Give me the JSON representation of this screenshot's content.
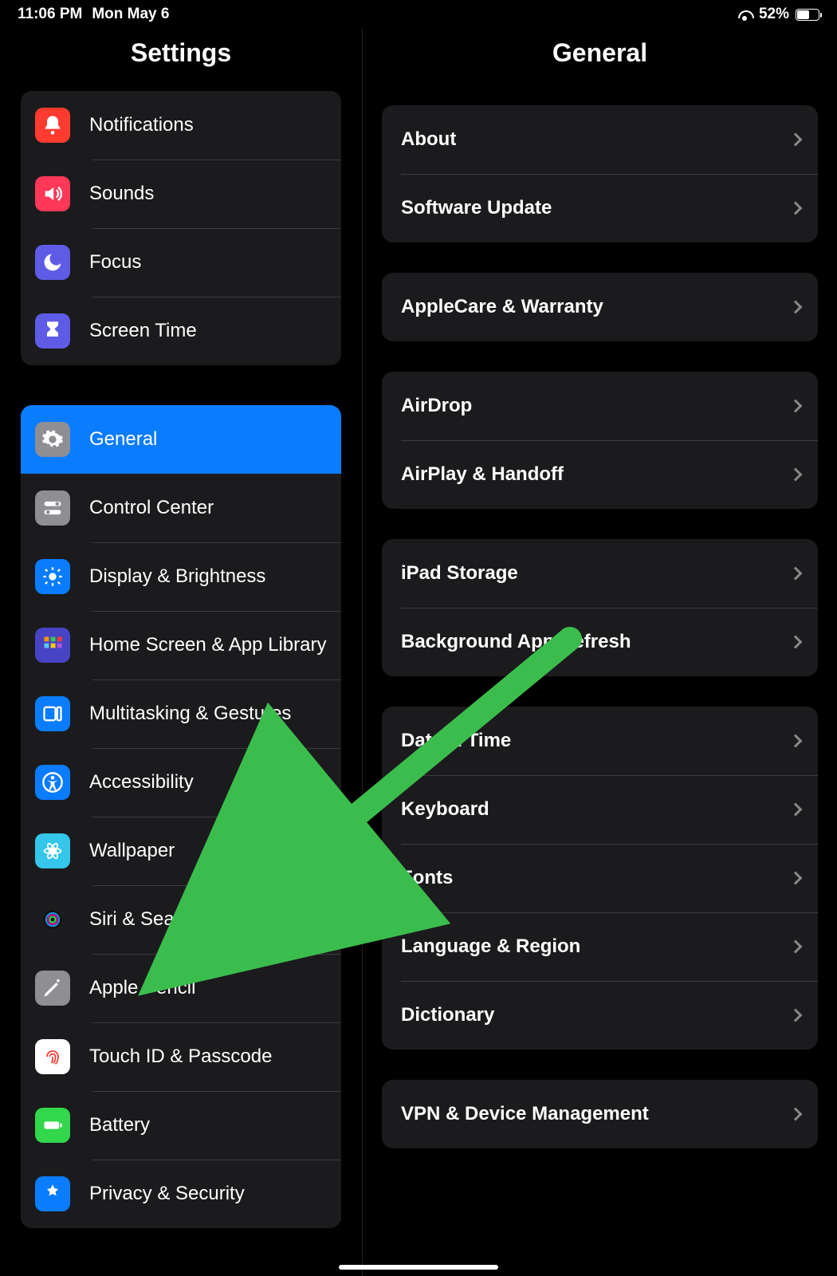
{
  "statusbar": {
    "time": "11:06 PM",
    "date": "Mon May 6",
    "battery_pct": "52%"
  },
  "sidebar": {
    "title": "Settings",
    "sections": [
      {
        "items": [
          {
            "id": "notifications",
            "label": "Notifications",
            "icon": "bell-badge-icon",
            "color": "#ff3b30"
          },
          {
            "id": "sounds",
            "label": "Sounds",
            "icon": "speaker-icon",
            "color": "#ff3758"
          },
          {
            "id": "focus",
            "label": "Focus",
            "icon": "moon-icon",
            "color": "#5e5ce6"
          },
          {
            "id": "screen-time",
            "label": "Screen Time",
            "icon": "hourglass-icon",
            "color": "#5e5ce6"
          }
        ]
      },
      {
        "items": [
          {
            "id": "general",
            "label": "General",
            "icon": "gear-icon",
            "color": "#8e8e93",
            "selected": true
          },
          {
            "id": "control-center",
            "label": "Control Center",
            "icon": "toggles-icon",
            "color": "#8e8e93"
          },
          {
            "id": "display-brightness",
            "label": "Display & Brightness",
            "icon": "sun-icon",
            "color": "#0a7cff"
          },
          {
            "id": "home-screen",
            "label": "Home Screen & App Library",
            "icon": "grid-icon",
            "color": "#4644c5"
          },
          {
            "id": "multitasking",
            "label": "Multitasking & Gestures",
            "icon": "multitask-icon",
            "color": "#0a7cff"
          },
          {
            "id": "accessibility",
            "label": "Accessibility",
            "icon": "accessibility-icon",
            "color": "#0a7cff"
          },
          {
            "id": "wallpaper",
            "label": "Wallpaper",
            "icon": "flower-icon",
            "color": "#34c6eb"
          },
          {
            "id": "siri-search",
            "label": "Siri & Search",
            "icon": "siri-icon",
            "color": "#1c1c1e"
          },
          {
            "id": "apple-pencil",
            "label": "Apple Pencil",
            "icon": "pencil-icon",
            "color": "#8e8e93"
          },
          {
            "id": "touchid-passcode",
            "label": "Touch ID & Passcode",
            "icon": "fingerprint-icon",
            "color": "#ffffff"
          },
          {
            "id": "battery",
            "label": "Battery",
            "icon": "battery-icon",
            "color": "#32d74b"
          },
          {
            "id": "privacy-security",
            "label": "Privacy & Security",
            "icon": "hand-icon",
            "color": "#0a7cff"
          }
        ]
      }
    ]
  },
  "detail": {
    "title": "General",
    "groups": [
      [
        {
          "id": "about",
          "label": "About"
        },
        {
          "id": "software-update",
          "label": "Software Update"
        }
      ],
      [
        {
          "id": "applecare",
          "label": "AppleCare & Warranty"
        }
      ],
      [
        {
          "id": "airdrop",
          "label": "AirDrop"
        },
        {
          "id": "airplay-handoff",
          "label": "AirPlay & Handoff"
        }
      ],
      [
        {
          "id": "ipad-storage",
          "label": "iPad Storage"
        },
        {
          "id": "background-refresh",
          "label": "Background App Refresh"
        }
      ],
      [
        {
          "id": "date-time",
          "label": "Date & Time"
        },
        {
          "id": "keyboard",
          "label": "Keyboard"
        },
        {
          "id": "fonts",
          "label": "Fonts"
        },
        {
          "id": "language-region",
          "label": "Language & Region"
        },
        {
          "id": "dictionary",
          "label": "Dictionary"
        }
      ],
      [
        {
          "id": "vpn-device-mgmt",
          "label": "VPN & Device Management"
        }
      ]
    ]
  },
  "annotation": {
    "arrow_target": "wallpaper",
    "arrow_color": "#3bbd4e"
  }
}
